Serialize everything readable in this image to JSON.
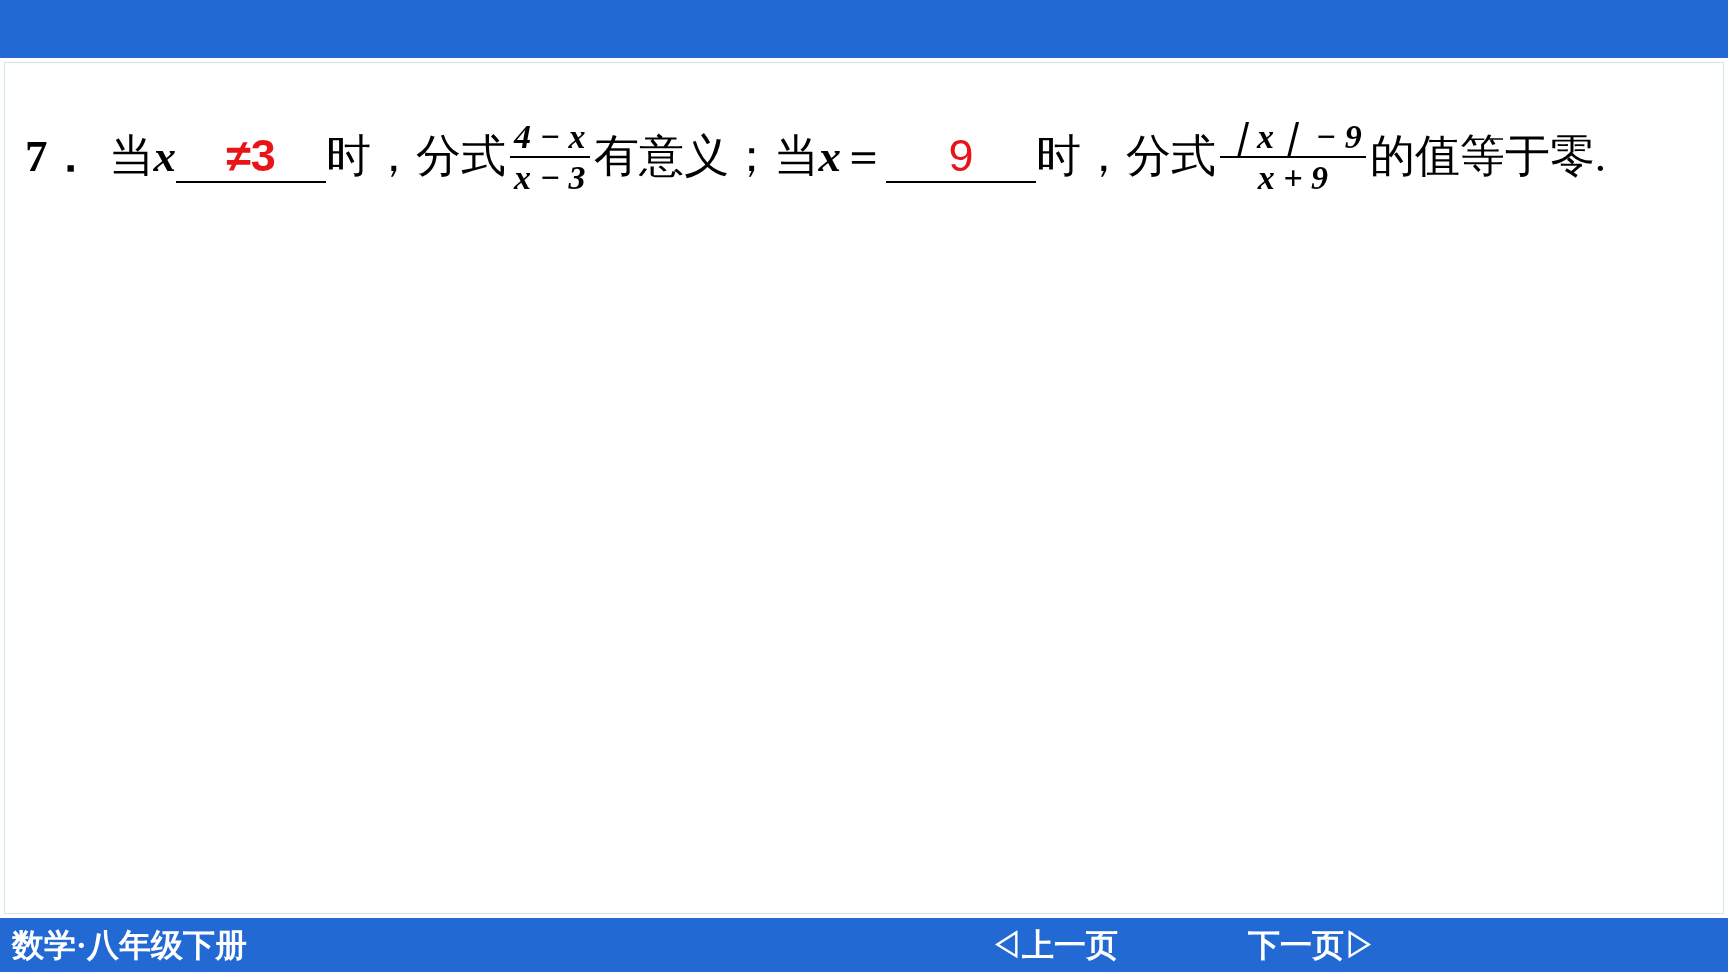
{
  "question": {
    "number": "7．",
    "parts": [
      {
        "kind": "text",
        "text": "当"
      },
      {
        "kind": "var",
        "text": "x"
      },
      {
        "kind": "blank",
        "answer": "≠3",
        "bold": true
      },
      {
        "kind": "text",
        "text": "时，分式"
      },
      {
        "kind": "fraction",
        "numerator": "4 − x",
        "denominator": "x − 3"
      },
      {
        "kind": "text",
        "text": "有意义；当"
      },
      {
        "kind": "var",
        "text": "x"
      },
      {
        "kind": "text",
        "text": "＝"
      },
      {
        "kind": "blank",
        "answer": "9",
        "bold": false
      },
      {
        "kind": "text",
        "text": "时，分式"
      },
      {
        "kind": "fraction",
        "numerator": "｜x｜ − 9",
        "denominator": "x + 9"
      },
      {
        "kind": "text",
        "text": "的值等于零."
      }
    ]
  },
  "footer": {
    "book": "数学·八年级下册",
    "prev": "◁上一页",
    "next": "下一页▷"
  }
}
